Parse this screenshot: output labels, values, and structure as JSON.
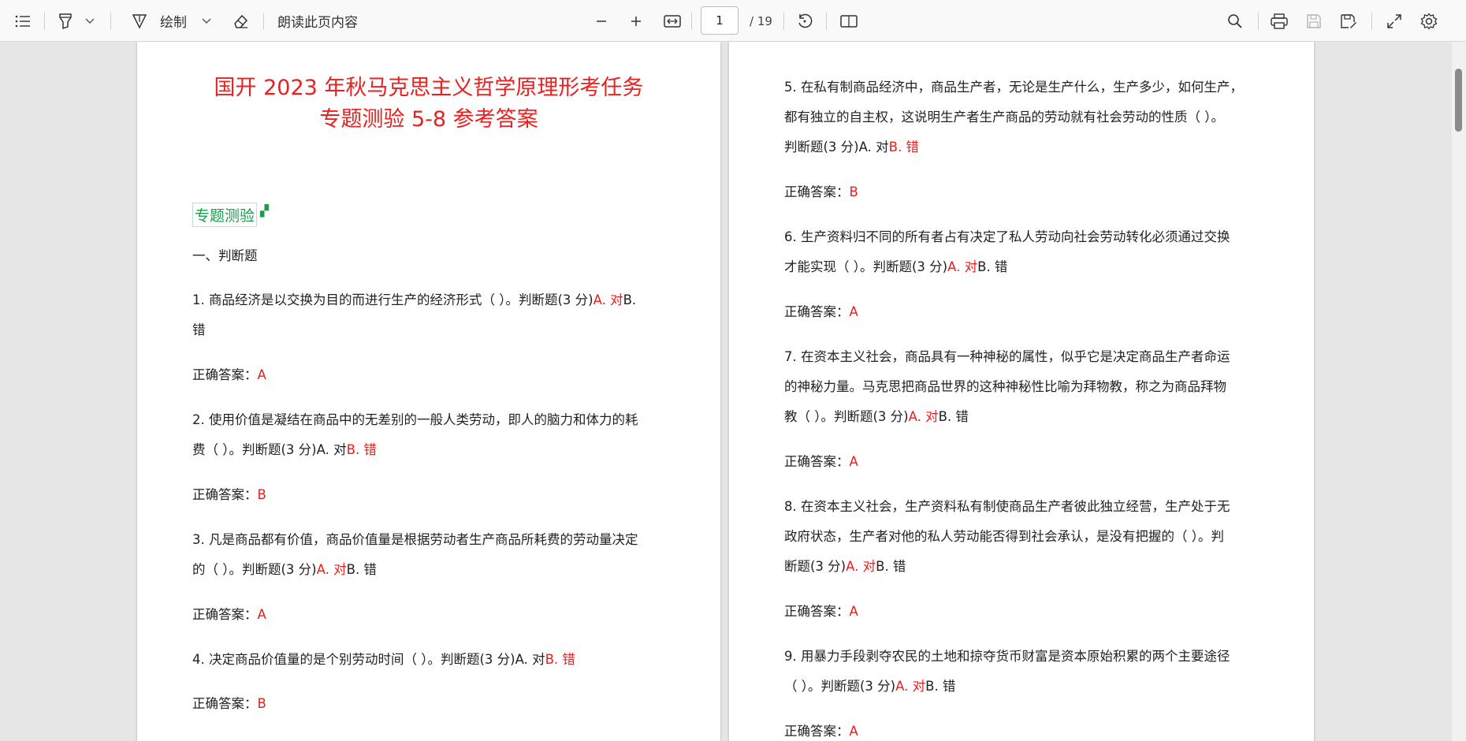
{
  "toolbar": {
    "draw_label": "绘制",
    "read_aloud_label": "朗读此页内容",
    "page_number": "1",
    "page_total": "/ 19"
  },
  "document": {
    "title_line1": "国开 2023 年秋马克思主义哲学原理形考任务",
    "title_line2": "专题测验 5-8 参考答案",
    "section_tag": "专题测验",
    "section_heading": "一、判断题",
    "answer_label": "正确答案：",
    "left": {
      "q1": {
        "line1": "1. 商品经济是以交换为目的而进行生产的经济形式（ ）。判断题(3 分)",
        "opt_a": "A. 对",
        "opt_b": "B.",
        "line2": "错",
        "answer": "A"
      },
      "q2": {
        "line1": "2. 使用价值是凝结在商品中的无差别的一般人类劳动，即人的脑力和体力的耗",
        "line2_pre": "费（ ）。判断题(3 分)",
        "opt_a": "A. 对",
        "opt_b": "B. 错",
        "answer": "B"
      },
      "q3": {
        "line1": "3. 凡是商品都有价值，商品价值量是根据劳动者生产商品所耗费的劳动量决定",
        "line2_pre": "的（ ）。判断题(3 分)",
        "opt_a": "A. 对",
        "opt_b": "B. 错",
        "answer": "A"
      },
      "q4": {
        "line1_pre": "4. 决定商品价值量的是个别劳动时间（ ）。判断题(3 分)",
        "opt_a": "A. 对",
        "opt_b": "B. 错",
        "answer": "B"
      }
    },
    "right": {
      "q5": {
        "line1": "5. 在私有制商品经济中，商品生产者，无论是生产什么，生产多少，如何生产，",
        "line2": "都有独立的自主权，这说明生产者生产商品的劳动就有社会劳动的性质（ ）。",
        "line3_pre": "判断题(3 分)",
        "opt_a": "A. 对",
        "opt_b": "B. 错",
        "answer": "B"
      },
      "q6": {
        "line1": "6. 生产资料归不同的所有者占有决定了私人劳动向社会劳动转化必须通过交换",
        "line2_pre": "才能实现（ ）。判断题(3 分)",
        "opt_a": "A. 对",
        "opt_b": "B. 错",
        "answer": "A"
      },
      "q7": {
        "line1": "7. 在资本主义社会，商品具有一种神秘的属性，似乎它是决定商品生产者命运",
        "line2": "的神秘力量。马克思把商品世界的这种神秘性比喻为拜物教，称之为商品拜物",
        "line3_pre": "教（ ）。判断题(3 分)",
        "opt_a": "A. 对",
        "opt_b": "B. 错",
        "answer": "A"
      },
      "q8": {
        "line1": "8. 在资本主义社会，生产资料私有制使商品生产者彼此独立经营，生产处于无",
        "line2": "政府状态，生产者对他的私人劳动能否得到社会承认，是没有把握的（ ）。判",
        "line3_pre": "断题(3 分)",
        "opt_a": "A. 对",
        "opt_b": "B. 错",
        "answer": "A"
      },
      "q9": {
        "line1": "9. 用暴力手段剥夺农民的土地和掠夺货币财富是资本原始积累的两个主要途径",
        "line2_pre": "（ ）。判断题(3 分)",
        "opt_a": "A. 对",
        "opt_b": "B. 错",
        "answer": "A"
      }
    }
  }
}
